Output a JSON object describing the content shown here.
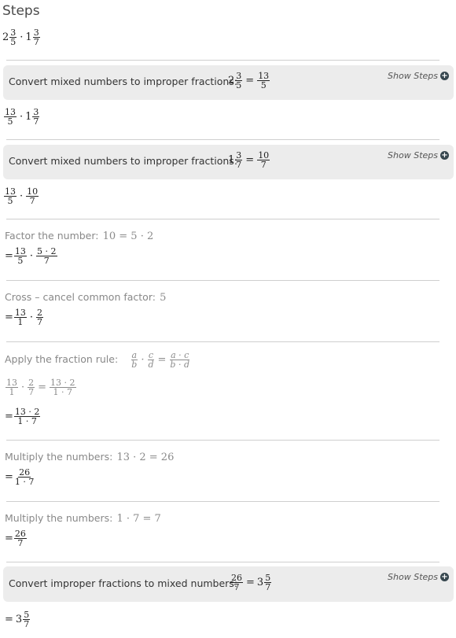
{
  "title": "Steps",
  "show_steps_label": "Show Steps",
  "problem": {
    "w1": "2",
    "n1": "3",
    "d1": "5",
    "dot": "·",
    "w2": "1",
    "n2": "3",
    "d2": "7"
  },
  "step1": {
    "label": "Convert mixed numbers to improper fractions:",
    "lhs_whole": "2",
    "lhs_num": "3",
    "lhs_den": "5",
    "eq": "=",
    "rhs_num": "13",
    "rhs_den": "5"
  },
  "result1": {
    "n1": "13",
    "d1": "5",
    "dot": "·",
    "w2": "1",
    "n2": "3",
    "d2": "7"
  },
  "step2": {
    "label": "Convert mixed numbers to improper fractions:",
    "lhs_whole": "1",
    "lhs_num": "3",
    "lhs_den": "7",
    "eq": "=",
    "rhs_num": "10",
    "rhs_den": "7"
  },
  "result2": {
    "n1": "13",
    "d1": "5",
    "dot": "·",
    "n2": "10",
    "d2": "7"
  },
  "step3": {
    "label": "Factor the number:",
    "expr": "10 = 5 ·  2"
  },
  "result3": {
    "eq": "=",
    "n1": "13",
    "d1": "5",
    "dot": "·",
    "n2": "5 ·  2",
    "d2": "7"
  },
  "step4": {
    "label": "Cross – cancel common factor:",
    "expr": "5"
  },
  "result4": {
    "eq": "=",
    "n1": "13",
    "d1": "1",
    "dot": "·",
    "n2": "2",
    "d2": "7"
  },
  "step5": {
    "label": "Apply the fraction rule:",
    "a": "a",
    "b": "b",
    "c": "c",
    "d": "d",
    "dot": "·",
    "eq": "=",
    "rn": "a · c",
    "rd": "b · d"
  },
  "step5_apply": {
    "n1": "13",
    "d1": "1",
    "dot": "·",
    "n2": "2",
    "d2": "7",
    "eq": "=",
    "rn": "13 ·  2",
    "rd": "1 · 7"
  },
  "result5": {
    "eq": "=",
    "n": "13 ·  2",
    "d": "1 · 7"
  },
  "step6": {
    "label": "Multiply the numbers:",
    "expr": "13 ·  2 = 26"
  },
  "result6": {
    "eq": "=",
    "n": "26",
    "d": "1 · 7"
  },
  "step7": {
    "label": "Multiply the numbers:",
    "expr": "1 ·  7 = 7"
  },
  "result7": {
    "eq": "=",
    "n": "26",
    "d": "7"
  },
  "step8": {
    "label": "Convert improper fractions to mixed numbers:",
    "lhs_num": "26",
    "lhs_den": "7",
    "eq": "=",
    "rhs_whole": "3",
    "rhs_num": "5",
    "rhs_den": "7"
  },
  "final": {
    "eq": "=",
    "whole": "3",
    "num": "5",
    "den": "7"
  }
}
